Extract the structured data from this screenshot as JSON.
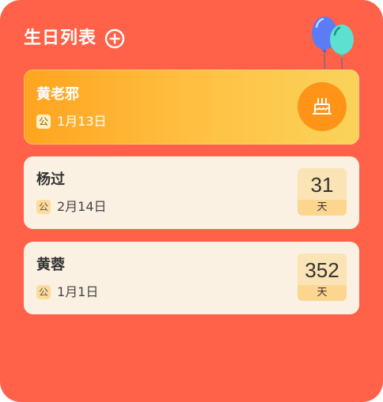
{
  "header": {
    "title": "生日列表"
  },
  "icons": {
    "add": "plus-circle-icon",
    "balloons": "balloons-icon",
    "cake": "birthday-cake-icon"
  },
  "colors": {
    "background": "#ff6149",
    "highlight_gradient_start": "#ffa41f",
    "highlight_gradient_end": "#fad35b",
    "card": "#fbf1e2",
    "cake_circle": "#ff9418",
    "days_top": "#fae3b4",
    "days_bottom": "#fcd68f"
  },
  "birthdays": [
    {
      "name": "黄老邪",
      "calendar": "公",
      "date": "1月13日",
      "is_today": true
    },
    {
      "name": "杨过",
      "calendar": "公",
      "date": "2月14日",
      "days_left": "31",
      "days_unit": "天"
    },
    {
      "name": "黄蓉",
      "calendar": "公",
      "date": "1月1日",
      "days_left": "352",
      "days_unit": "天"
    }
  ]
}
